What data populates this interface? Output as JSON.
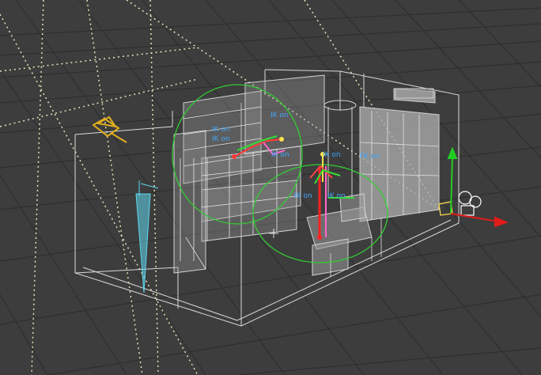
{
  "viewport": {
    "colors": {
      "background": "#3d3d3d",
      "grid": "#2f2f2f",
      "guide": "#e8e2b8",
      "wireframe": "#d9d9d9",
      "solid": "#a9a9a9",
      "rig_circle": "#33cc33",
      "ik_label": "#3fa7ff",
      "axis_x": "#e21b1b",
      "axis_y": "#22cc22",
      "light": "#e0b020",
      "spotlight": "#5fd7ee",
      "camera": "#ffffff"
    },
    "rig_labels": [
      "IK on",
      "IK on",
      "IK on",
      "IK on",
      "IK on",
      "FK on",
      "IK on",
      "IK on"
    ],
    "icons": {
      "light": "point-light-icon",
      "spot": "spotlight-icon",
      "camera": "camera-icon",
      "gizmo": "transform-gizmo-icon"
    }
  }
}
